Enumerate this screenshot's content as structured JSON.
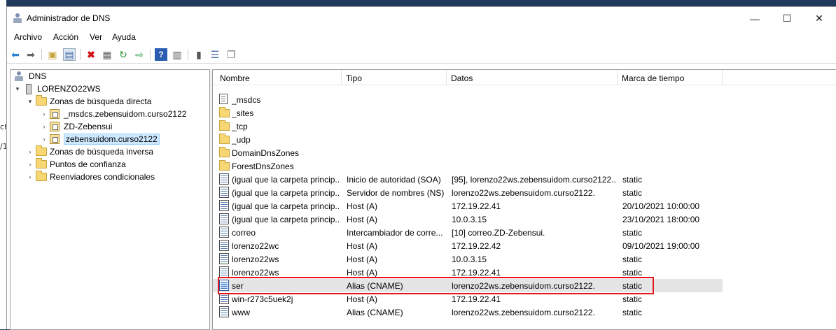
{
  "window": {
    "title": "Administrador de DNS"
  },
  "controls": {
    "minimize": "—",
    "maximize": "☐",
    "close": "✕"
  },
  "menu": [
    "Archivo",
    "Acción",
    "Ver",
    "Ayuda"
  ],
  "background_text": [
    "ch",
    "/1"
  ],
  "toolbar": {
    "icons": [
      "back-icon",
      "forward-icon",
      "up-folder-icon",
      "show-hide-tree-icon",
      "delete-icon",
      "properties-icon",
      "refresh-icon",
      "export-icon",
      "help-icon",
      "console-view-icon",
      "server-icon",
      "list-icon",
      "copy-icon"
    ]
  },
  "tree": {
    "root": "DNS",
    "server": "LORENZO22WS",
    "nodes": [
      {
        "label": "Zonas de búsqueda directa",
        "expanded": true
      },
      {
        "label": "_msdcs.zebensuidom.curso2122"
      },
      {
        "label": "ZD-Zebensui"
      },
      {
        "label": "zebensuidom.curso2122",
        "selected": true
      },
      {
        "label": "Zonas de búsqueda inversa"
      },
      {
        "label": "Puntos de confianza"
      },
      {
        "label": "Reenviadores condicionales"
      }
    ]
  },
  "list": {
    "columns": [
      "Nombre",
      "Tipo",
      "Datos",
      "Marca de tiempo"
    ],
    "rows": [
      {
        "icon": "zone-doc-icon",
        "name": "_msdcs",
        "type": "",
        "data": "",
        "time": ""
      },
      {
        "icon": "folder-icon",
        "name": "_sites",
        "type": "",
        "data": "",
        "time": ""
      },
      {
        "icon": "folder-icon",
        "name": "_tcp",
        "type": "",
        "data": "",
        "time": ""
      },
      {
        "icon": "folder-icon",
        "name": "_udp",
        "type": "",
        "data": "",
        "time": ""
      },
      {
        "icon": "folder-icon",
        "name": "DomainDnsZones",
        "type": "",
        "data": "",
        "time": ""
      },
      {
        "icon": "folder-icon",
        "name": "ForestDnsZones",
        "type": "",
        "data": "",
        "time": ""
      },
      {
        "icon": "record-icon",
        "name": "(igual que la carpeta princip...",
        "type": "Inicio de autoridad (SOA)",
        "data": "[95], lorenzo22ws.zebensuidom.curso2122....",
        "time": "static"
      },
      {
        "icon": "record-icon",
        "name": "(igual que la carpeta princip...",
        "type": "Servidor de nombres (NS)",
        "data": "lorenzo22ws.zebensuidom.curso2122.",
        "time": "static"
      },
      {
        "icon": "record-icon",
        "name": "(igual que la carpeta princip...",
        "type": "Host (A)",
        "data": "172.19.22.41",
        "time": "20/10/2021 10:00:00"
      },
      {
        "icon": "record-icon",
        "name": "(igual que la carpeta princip...",
        "type": "Host (A)",
        "data": "10.0.3.15",
        "time": "23/10/2021 18:00:00"
      },
      {
        "icon": "record-icon",
        "name": "correo",
        "type": "Intercambiador de corre...",
        "data": "[10]  correo.ZD-Zebensui.",
        "time": "static"
      },
      {
        "icon": "record-icon",
        "name": "lorenzo22wc",
        "type": "Host (A)",
        "data": "172.19.22.42",
        "time": "09/10/2021 19:00:00"
      },
      {
        "icon": "record-icon",
        "name": "lorenzo22ws",
        "type": "Host (A)",
        "data": "10.0.3.15",
        "time": "static"
      },
      {
        "icon": "record-icon",
        "name": "lorenzo22ws",
        "type": "Host (A)",
        "data": "172.19.22.41",
        "time": "static"
      },
      {
        "icon": "record-icon",
        "name": "ser",
        "type": "Alias (CNAME)",
        "data": "lorenzo22ws.zebensuidom.curso2122.",
        "time": "static",
        "highlighted": true
      },
      {
        "icon": "record-icon",
        "name": "win-r273c5uek2j",
        "type": "Host (A)",
        "data": "172.19.22.41",
        "time": "static"
      },
      {
        "icon": "record-icon",
        "name": "www",
        "type": "Alias (CNAME)",
        "data": "lorenzo22ws.zebensuidom.curso2122.",
        "time": "static"
      }
    ]
  },
  "colors": {
    "highlight_border": "#e8141b",
    "selection": "#cce8ff"
  }
}
